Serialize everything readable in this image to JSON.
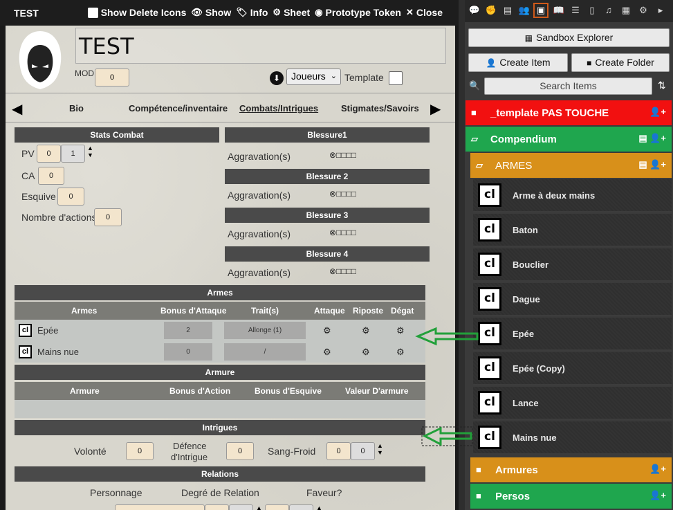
{
  "sheet": {
    "window_title": "TEST",
    "toolbar": {
      "show_delete_icons": "Show Delete Icons",
      "show": "Show",
      "info": "Info",
      "sheet": "Sheet",
      "prototype_token": "Prototype Token",
      "close": "Close"
    },
    "name": "TEST",
    "mod_label": "MOD",
    "mod_value": "0",
    "owner_select": "Joueurs",
    "template_label": "Template",
    "tabs": [
      "Bio",
      "Compétence/inventaire",
      "Combats/Intrigues",
      "Stigmates/Savoirs"
    ],
    "active_tab": "Combats/Intrigues",
    "stats": {
      "header": "Stats Combat",
      "pv_label": "PV",
      "pv_value": "0",
      "pv_max": "1",
      "ca_label": "CA",
      "ca_value": "0",
      "esquive_label": "Esquive",
      "esquive_value": "0",
      "actions_label": "Nombre d'actions",
      "actions_value": "0"
    },
    "wounds": [
      {
        "header": "Blessure1",
        "label": "Aggravation(s)",
        "boxes": "⊗□□□□"
      },
      {
        "header": "Blessure 2",
        "label": "Aggravation(s)",
        "boxes": "⊗□□□□"
      },
      {
        "header": "Blessure 3",
        "label": "Aggravation(s)",
        "boxes": "⊗□□□□"
      },
      {
        "header": "Blessure 4",
        "label": "Aggravation(s)",
        "boxes": "⊗□□□□"
      }
    ],
    "armes": {
      "header": "Armes",
      "columns": [
        "Armes",
        "Bonus d'Attaque",
        "Trait(s)",
        "Attaque",
        "Riposte",
        "Dégat"
      ],
      "rows": [
        {
          "icon": "cl",
          "name": "Epée",
          "bonus": "2",
          "traits": "Allonge (1)"
        },
        {
          "icon": "cl",
          "name": "Mains nue",
          "bonus": "0",
          "traits": "/"
        }
      ]
    },
    "armure": {
      "header": "Armure",
      "columns": [
        "Armure",
        "Bonus d'Action",
        "Bonus d'Esquive",
        "Valeur D'armure"
      ]
    },
    "intrigues": {
      "header": "Intrigues",
      "volonte_label": "Volonté",
      "volonte_value": "0",
      "defence_label_1": "Défence",
      "defence_label_2": "d'Intrigue",
      "defence_value": "0",
      "sangfroid_label": "Sang-Froid",
      "sangfroid_value": "0",
      "sangfroid_max": "0"
    },
    "relations": {
      "header": "Relations",
      "columns": [
        "Personnage",
        "Degré de Relation",
        "Faveur?"
      ]
    }
  },
  "sidebar": {
    "tabs": [
      "chat-icon",
      "combat-icon",
      "map-icon",
      "actors-icon",
      "items-icon",
      "journal-icon",
      "tables-icon",
      "cards-icon",
      "playlists-icon",
      "compendium-icon",
      "settings-icon",
      "collapse-icon"
    ],
    "active_tab": "items-icon",
    "sandbox_explorer": "Sandbox Explorer",
    "create_item": "Create Item",
    "create_folder": "Create Folder",
    "search_placeholder": "Search Items",
    "folders": [
      {
        "name": "_template PAS TOUCHE",
        "color": "#f21010"
      },
      {
        "name": "Compendium",
        "color": "#1fa64e"
      },
      {
        "name": "ARMES",
        "color": "#d8901a"
      },
      {
        "name": "Armures",
        "color": "#d8901a"
      },
      {
        "name": "Persos",
        "color": "#1fa64e"
      }
    ],
    "items": [
      {
        "icon": "cl",
        "name": "Arme à deux mains"
      },
      {
        "icon": "cl",
        "name": "Baton"
      },
      {
        "icon": "cl",
        "name": "Bouclier"
      },
      {
        "icon": "cl",
        "name": "Dague"
      },
      {
        "icon": "cl",
        "name": "Epée"
      },
      {
        "icon": "cl",
        "name": "Epée (Copy)"
      },
      {
        "icon": "cl",
        "name": "Lance"
      },
      {
        "icon": "cl",
        "name": "Mains nue"
      }
    ]
  }
}
